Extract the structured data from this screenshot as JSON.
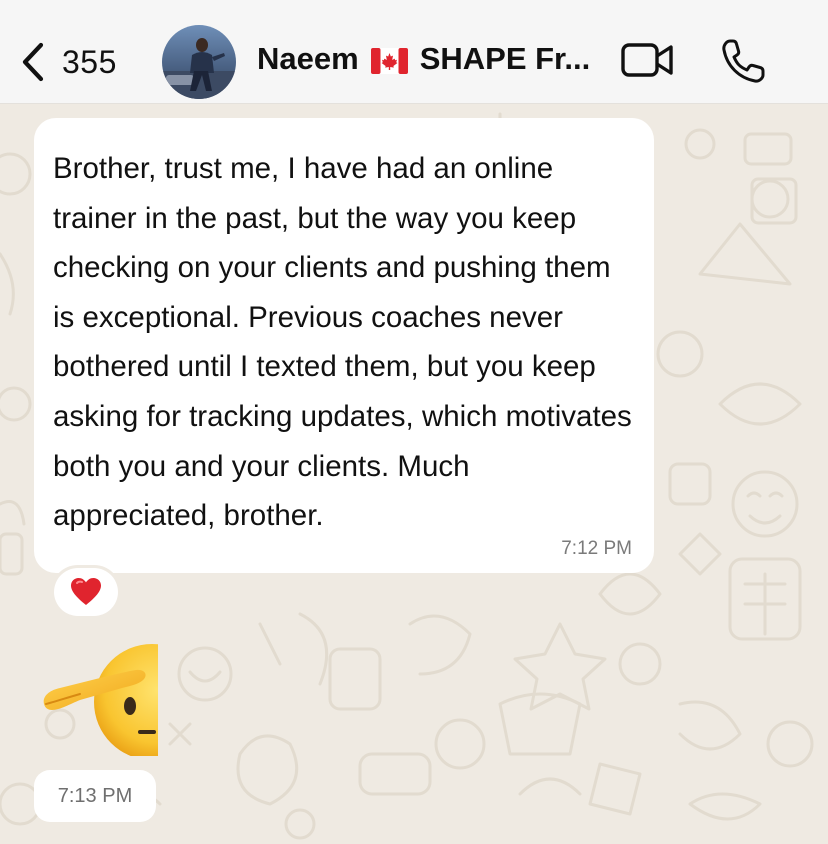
{
  "header": {
    "back_count": "355",
    "contact_name_first": "Naeem",
    "flag_icon": "canada-flag-icon",
    "contact_name_rest": "SHAPE Fr...",
    "video_icon": "video-camera-icon",
    "call_icon": "phone-icon"
  },
  "messages": [
    {
      "direction": "incoming",
      "text": "Brother, trust me, I have had an online trainer in the past, but the way you keep checking on your clients and pushing them is exceptional. Previous coaches never bothered until I texted them, but you keep asking for tracking updates, which motivates both you and your clients. Much appreciated, brother.",
      "time": "7:12 PM",
      "reaction": "❤️"
    },
    {
      "direction": "incoming",
      "sticker": "saluting-face-emoji",
      "time": "7:13 PM"
    }
  ],
  "colors": {
    "wallpaper": "#efeae2",
    "header_bg": "#f6f6f6",
    "bubble_incoming": "#ffffff",
    "reaction_heart": "#e0242e"
  }
}
